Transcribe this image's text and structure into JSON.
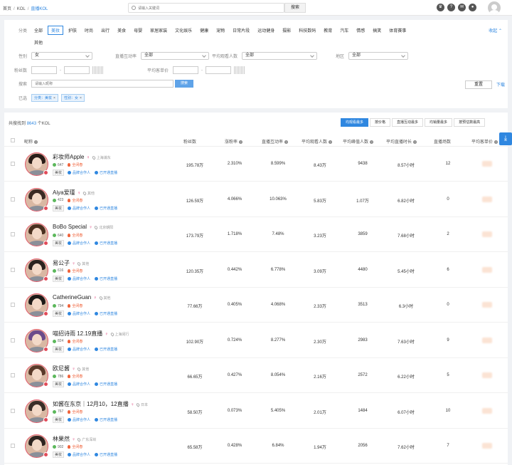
{
  "breadcrumb": {
    "home": "首页",
    "kol": "KOL",
    "current": "直播KOL"
  },
  "search": {
    "placeholder": "请输入关键词",
    "button": "搜索"
  },
  "filters": {
    "category_label": "分类",
    "categories": [
      "全部",
      "美妆",
      "护肤",
      "时尚",
      "出行",
      "美食",
      "母婴",
      "家居家装",
      "文化娱乐",
      "健康",
      "宠物",
      "日常片段",
      "运动健身",
      "摄影",
      "科技数码",
      "教育",
      "汽车",
      "情感",
      "搞笑",
      "体育赛事"
    ],
    "categories_row2": [
      "其他"
    ],
    "active_category": "美妆",
    "collapse": "收起",
    "gender_label": "性别",
    "gender_value": "女",
    "interaction_label": "直播互动率",
    "interaction_value": "全部",
    "viewers_label": "平均观看人数",
    "viewers_value": "全部",
    "region_label": "地区",
    "region_value": "全部",
    "fans_label": "粉丝数",
    "price_label": "平均客单价",
    "keyword_label": "搜索",
    "keyword_placeholder": "请输入昵称",
    "keyword_button": "搜索",
    "reset": "重置",
    "download": "下载",
    "selected_label": "已选",
    "selected": [
      "分类：美妆",
      "性别：女"
    ]
  },
  "results": {
    "prefix": "共搜找到",
    "count": "8643",
    "suffix": "个KOL",
    "sort_tabs": [
      "均观看最多",
      "按价格",
      "直播互动最多",
      "均销量最多",
      "按预估数最高"
    ],
    "headers": [
      "昵称",
      "粉丝数",
      "涨粉率",
      "直播互动率",
      "平均观看人数",
      "平均峰值人数",
      "平均直播时长",
      "直播场数",
      "平均客单价"
    ]
  },
  "rows": [
    {
      "name": "彩妆师Apple",
      "gender": "♀",
      "loc": "上海浦东",
      "score": "647",
      "hot": "全闭春",
      "cat": "美妆",
      "t1": "品牌合作人",
      "t2": "已开通直播",
      "fans": "195.78万",
      "growth": "2.310%",
      "inter": "8.599%",
      "avg": "8.43万",
      "peak": "9438",
      "dur": "8.57小时",
      "count": "12"
    },
    {
      "name": "Aiya爱瑾",
      "gender": "♀",
      "loc": "其他",
      "score": "423",
      "hot": "全闭春",
      "cat": "美妆",
      "t1": "品牌合作人",
      "t2": "已开通直播",
      "fans": "126.59万",
      "growth": "4.066%",
      "inter": "10.063%",
      "avg": "5.83万",
      "peak": "1.07万",
      "dur": "6.82小时",
      "count": "0"
    },
    {
      "name": "BoBo Special",
      "gender": "♀",
      "loc": "北京朝阳",
      "score": "640",
      "hot": "全闭春",
      "cat": "美妆",
      "t1": "品牌合作人",
      "t2": "已开通直播",
      "fans": "173.79万",
      "growth": "1.718%",
      "inter": "7.48%",
      "avg": "3.23万",
      "peak": "3859",
      "dur": "7.68小时",
      "count": "2"
    },
    {
      "name": "易公子",
      "gender": "♀",
      "loc": "其他",
      "score": "616",
      "hot": "全闭春",
      "cat": "美妆",
      "t1": "品牌合作人",
      "t2": "已开通直播",
      "fans": "120.35万",
      "growth": "0.442%",
      "inter": "6.778%",
      "avg": "3.09万",
      "peak": "4480",
      "dur": "5.45小时",
      "count": "6"
    },
    {
      "name": "CatherineGuan",
      "gender": "♀",
      "loc": "其他",
      "score": "794",
      "hot": "全闭春",
      "cat": "美妆",
      "t1": "品牌合作人",
      "t2": "已开通直播",
      "fans": "77.66万",
      "growth": "0.405%",
      "inter": "4.068%",
      "avg": "2.33万",
      "peak": "3513",
      "dur": "6.3小时",
      "count": "0"
    },
    {
      "name": "喵招诗雨 12.19直播",
      "gender": "♀",
      "loc": "上海闵行",
      "score": "824",
      "hot": "全闭春",
      "cat": "美妆",
      "t1": "品牌合作人",
      "t2": "已开通直播",
      "fans": "102.90万",
      "growth": "0.724%",
      "inter": "8.277%",
      "avg": "2.30万",
      "peak": "2983",
      "dur": "7.63小时",
      "count": "9"
    },
    {
      "name": "欧尼酱",
      "gender": "♀",
      "loc": "其他",
      "score": "786",
      "hot": "全闭春",
      "cat": "美妆",
      "t1": "品牌合作人",
      "t2": "已开通直播",
      "fans": "66.65万",
      "growth": "0.427%",
      "inter": "8.054%",
      "avg": "2.16万",
      "peak": "2572",
      "dur": "6.22小时",
      "count": "5"
    },
    {
      "name": "如酱在东京｜12月10，12直播",
      "gender": "♀",
      "loc": "日本",
      "score": "767",
      "hot": "全闭春",
      "cat": "美妆",
      "t1": "品牌合作人",
      "t2": "已开通直播",
      "fans": "58.50万",
      "growth": "0.073%",
      "inter": "5.405%",
      "avg": "2.01万",
      "peak": "1484",
      "dur": "6.07小时",
      "count": "10"
    },
    {
      "name": "林果然",
      "gender": "♀",
      "loc": "广东深圳",
      "score": "902",
      "hot": "全闭春",
      "cat": "美妆",
      "t1": "品牌合作人",
      "t2": "已开通直播",
      "fans": "65.58万",
      "growth": "0.428%",
      "inter": "6.84%",
      "avg": "1.94万",
      "peak": "2056",
      "dur": "7.62小时",
      "count": "7"
    }
  ]
}
